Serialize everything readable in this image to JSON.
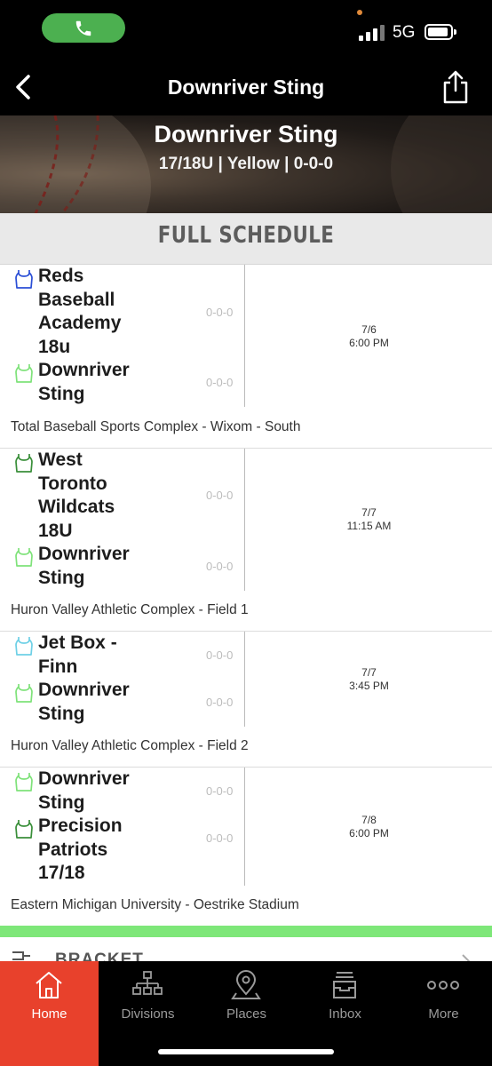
{
  "status_bar": {
    "network": "5G"
  },
  "nav": {
    "title": "Downriver Sting"
  },
  "hero": {
    "team_name": "Downriver Sting",
    "subtitle": "17/18U | Yellow | 0-0-0"
  },
  "section": {
    "title": "FULL SCHEDULE"
  },
  "games": [
    {
      "teams": [
        {
          "name": "Reds Baseball Academy 18u",
          "record": "0-0-0",
          "jersey_color": "#2b4fd6"
        },
        {
          "name": "Downriver Sting",
          "record": "0-0-0",
          "jersey_color": "#7fe27a"
        }
      ],
      "date": "7/6",
      "time": "6:00 PM",
      "venue": "Total Baseball Sports Complex - Wixom - South"
    },
    {
      "teams": [
        {
          "name": "West Toronto Wildcats 18U",
          "record": "0-0-0",
          "jersey_color": "#3a8f3a"
        },
        {
          "name": "Downriver Sting",
          "record": "0-0-0",
          "jersey_color": "#7fe27a"
        }
      ],
      "date": "7/7",
      "time": "11:15 AM",
      "venue": "Huron Valley Athletic Complex - Field 1"
    },
    {
      "teams": [
        {
          "name": "Jet Box - Finn",
          "record": "0-0-0",
          "jersey_color": "#6ed0e6"
        },
        {
          "name": "Downriver Sting",
          "record": "0-0-0",
          "jersey_color": "#7fe27a"
        }
      ],
      "date": "7/7",
      "time": "3:45 PM",
      "venue": "Huron Valley Athletic Complex - Field 2"
    },
    {
      "teams": [
        {
          "name": "Downriver Sting",
          "record": "0-0-0",
          "jersey_color": "#7fe27a"
        },
        {
          "name": "Precision Patriots 17/18",
          "record": "0-0-0",
          "jersey_color": "#3a8f3a"
        }
      ],
      "date": "7/8",
      "time": "6:00 PM",
      "venue": "Eastern Michigan University - Oestrike Stadium"
    }
  ],
  "bracket": {
    "label": "BRACKET"
  },
  "tabs": [
    {
      "label": "Home",
      "icon": "home-icon"
    },
    {
      "label": "Divisions",
      "icon": "divisions-icon"
    },
    {
      "label": "Places",
      "icon": "places-icon"
    },
    {
      "label": "Inbox",
      "icon": "inbox-icon"
    },
    {
      "label": "More",
      "icon": "more-icon"
    }
  ],
  "colors": {
    "active_tab": "#e8412c",
    "accent_green": "#7ee779",
    "call_pill": "#4cb050"
  }
}
